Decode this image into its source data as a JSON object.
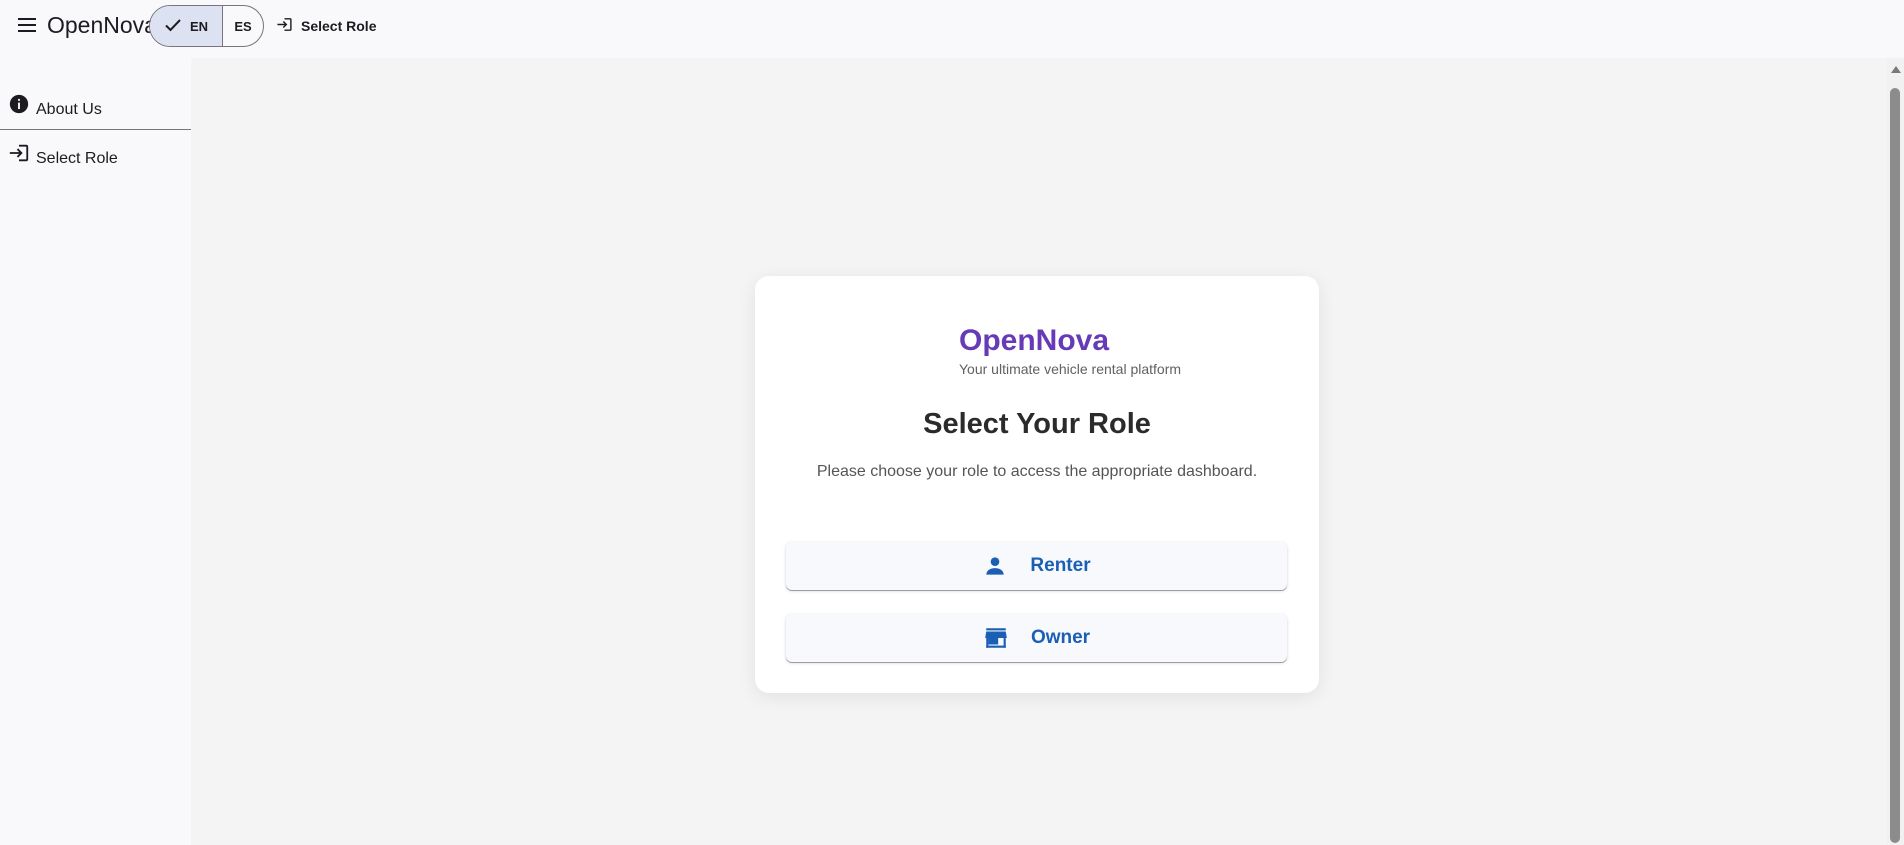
{
  "header": {
    "menu_icon": "menu-icon",
    "app_title": "OpenNova",
    "languages": [
      {
        "code": "EN",
        "selected": true
      },
      {
        "code": "ES",
        "selected": false
      }
    ],
    "check_icon": "check-icon",
    "nav_link_icon": "login-icon",
    "nav_link_label": "Select Role"
  },
  "sidebar": {
    "items": [
      {
        "icon": "info-icon",
        "label": "About Us"
      },
      {
        "icon": "login-icon",
        "label": "Select Role"
      }
    ]
  },
  "card": {
    "brand": "OpenNova",
    "tagline": "Your ultimate vehicle rental platform",
    "heading": "Select Your Role",
    "description": "Please choose your role to access the appropriate dashboard.",
    "buttons": [
      {
        "icon": "person-icon",
        "label": "Renter"
      },
      {
        "icon": "store-icon",
        "label": "Owner"
      }
    ]
  },
  "colors": {
    "brand": "#673ab7",
    "button_text": "#1a5fb4",
    "selected_segment": "#dde2f3",
    "main_bg": "#f4f4f4"
  }
}
